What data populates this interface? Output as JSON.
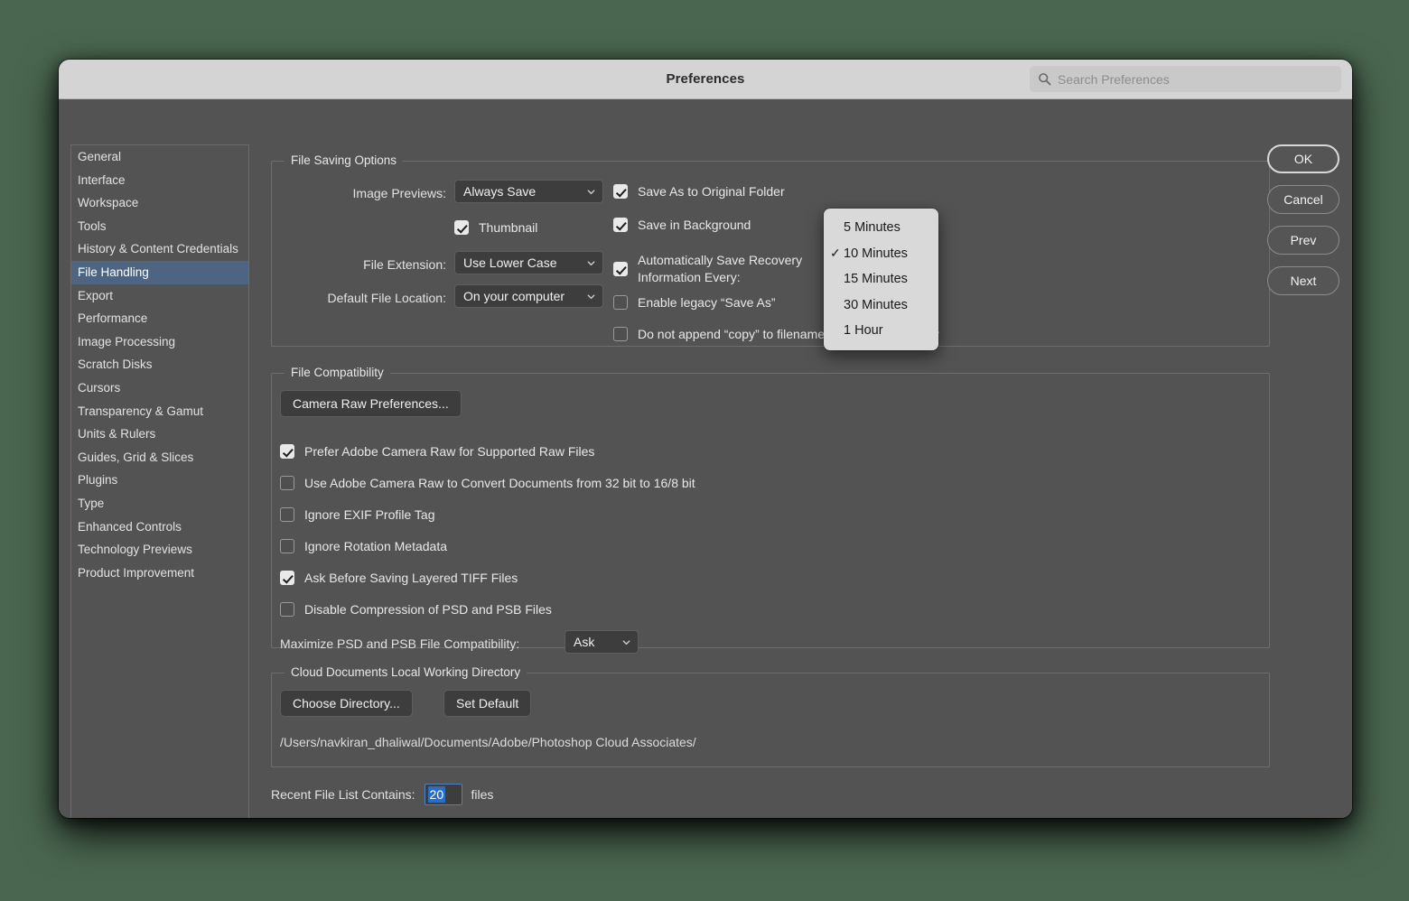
{
  "window": {
    "title": "Preferences",
    "search_placeholder": "Search Preferences",
    "search_value": ""
  },
  "sidebar": {
    "items": [
      {
        "label": "General",
        "selected": false
      },
      {
        "label": "Interface",
        "selected": false
      },
      {
        "label": "Workspace",
        "selected": false
      },
      {
        "label": "Tools",
        "selected": false
      },
      {
        "label": "History & Content Credentials",
        "selected": false
      },
      {
        "label": "File Handling",
        "selected": true
      },
      {
        "label": "Export",
        "selected": false
      },
      {
        "label": "Performance",
        "selected": false
      },
      {
        "label": "Image Processing",
        "selected": false
      },
      {
        "label": "Scratch Disks",
        "selected": false
      },
      {
        "label": "Cursors",
        "selected": false
      },
      {
        "label": "Transparency & Gamut",
        "selected": false
      },
      {
        "label": "Units & Rulers",
        "selected": false
      },
      {
        "label": "Guides, Grid & Slices",
        "selected": false
      },
      {
        "label": "Plugins",
        "selected": false
      },
      {
        "label": "Type",
        "selected": false
      },
      {
        "label": "Enhanced Controls",
        "selected": false
      },
      {
        "label": "Technology Previews",
        "selected": false
      },
      {
        "label": "Product Improvement",
        "selected": false
      }
    ]
  },
  "file_saving": {
    "legend": "File Saving Options",
    "image_previews_label": "Image Previews:",
    "image_previews_value": "Always Save",
    "thumbnail_label": "Thumbnail",
    "file_extension_label": "File Extension:",
    "file_extension_value": "Use Lower Case",
    "default_file_location_label": "Default File Location:",
    "default_file_location_value": "On your computer",
    "save_as_original_label": "Save As to Original Folder",
    "save_in_background_label": "Save in Background",
    "auto_save_recovery_line1": "Automatically Save Recovery",
    "auto_save_recovery_line2": "Information Every:",
    "enable_legacy_save_as_label": "Enable legacy “Save As”",
    "do_not_append_copy_label": "Do not append “copy” to filename when saving a copy"
  },
  "file_compatibility": {
    "legend": "File Compatibility",
    "camera_raw_button": "Camera Raw Preferences...",
    "checkboxes": [
      {
        "label": "Prefer Adobe Camera Raw for Supported Raw Files",
        "checked": true
      },
      {
        "label": "Use Adobe Camera Raw to Convert Documents from 32 bit to 16/8 bit",
        "checked": false
      },
      {
        "label": "Ignore EXIF Profile Tag",
        "checked": false
      },
      {
        "label": "Ignore Rotation Metadata",
        "checked": false
      },
      {
        "label": "Ask Before Saving Layered TIFF Files",
        "checked": true
      },
      {
        "label": "Disable Compression of PSD and PSB Files",
        "checked": false
      }
    ],
    "maximize_label": "Maximize PSD and PSB File Compatibility:",
    "maximize_value": "Ask"
  },
  "cloud_documents": {
    "legend": "Cloud Documents Local Working Directory",
    "choose_directory_button": "Choose Directory...",
    "set_default_button": "Set Default",
    "path": "/Users/navkiran_dhaliwal/Documents/Adobe/Photoshop Cloud Associates/"
  },
  "recent_files": {
    "label": "Recent File List Contains:",
    "value": "20",
    "suffix": "files"
  },
  "actions": {
    "ok": "OK",
    "cancel": "Cancel",
    "prev": "Prev",
    "next": "Next"
  },
  "recovery_popup": {
    "selected": "10 Minutes",
    "items": [
      {
        "label": "5 Minutes",
        "checked": false
      },
      {
        "label": "10 Minutes",
        "checked": true
      },
      {
        "label": "15 Minutes",
        "checked": false
      },
      {
        "label": "30 Minutes",
        "checked": false
      },
      {
        "label": "1 Hour",
        "checked": false
      }
    ]
  },
  "colors": {
    "desktop": "#4a6650",
    "window_bg": "#535353",
    "titlebar_bg": "#d4d4d4",
    "selection_blue": "#4d6580",
    "popup_bg": "#d9d9d9",
    "text_selection_blue": "#2a6dc4"
  },
  "icons": {
    "search": "search-icon",
    "chevron": "chevron-down-icon",
    "check": "✓"
  }
}
